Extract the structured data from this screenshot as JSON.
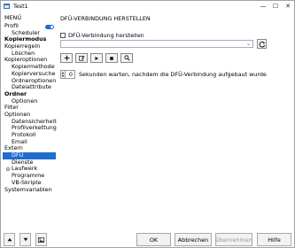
{
  "window": {
    "title": "Test1",
    "controls": [
      "—",
      "☐",
      "✕"
    ]
  },
  "sidebar": {
    "header": "MENÜ",
    "items": [
      {
        "label": "Profil",
        "level": 0,
        "bold": false,
        "toggle": true
      },
      {
        "label": "Scheduler",
        "level": 1
      },
      {
        "label": "Kopiermodus",
        "level": 0,
        "bold": true
      },
      {
        "label": "Kopierregeln",
        "level": 0
      },
      {
        "label": "Löschen",
        "level": 1
      },
      {
        "label": "Kopieroptionen",
        "level": 0
      },
      {
        "label": "Kopiermethode",
        "level": 1
      },
      {
        "label": "Kopierversuche",
        "level": 1
      },
      {
        "label": "Ordneroptionen",
        "level": 1
      },
      {
        "label": "Dateiattribute",
        "level": 1
      },
      {
        "label": "Ordner",
        "level": 0,
        "bold": true
      },
      {
        "label": "Optionen",
        "level": 1
      },
      {
        "label": "Filter",
        "level": 0
      },
      {
        "label": "Optionen",
        "level": 0
      },
      {
        "label": "Datensicherheit",
        "level": 1
      },
      {
        "label": "Profilverkettung",
        "level": 1
      },
      {
        "label": "Protokoll",
        "level": 1
      },
      {
        "label": "Email",
        "level": 1
      },
      {
        "label": "Extern",
        "level": 0
      },
      {
        "label": "DFÜ",
        "level": 1,
        "selected": true
      },
      {
        "label": "Dienste",
        "level": 1
      },
      {
        "label": "Laufwerk",
        "level": 1,
        "expander": true
      },
      {
        "label": "Programme",
        "level": 1
      },
      {
        "label": "VB-Skripte",
        "level": 1
      },
      {
        "label": "Systemvariablen",
        "level": 0
      }
    ]
  },
  "content": {
    "title": "DFÜ-VERBINDUNG HERSTELLEN",
    "checkbox_label": "DFÜ-Verbindung herstellen",
    "checkbox_checked": false,
    "connection_select_value": "",
    "toolbar_icons": [
      "plus-icon",
      "edit-icon",
      "play-icon",
      "stop-icon",
      "search-icon"
    ],
    "wait_value": "0",
    "wait_text": "Sekunden warten, nachdem die DFÜ-Verbindung aufgebaut wurde"
  },
  "footer": {
    "ok": "OK",
    "cancel": "Abbrechen",
    "apply": "Übernehmen",
    "help": "Hilfe"
  },
  "colors": {
    "accent": "#1f6dcc"
  }
}
